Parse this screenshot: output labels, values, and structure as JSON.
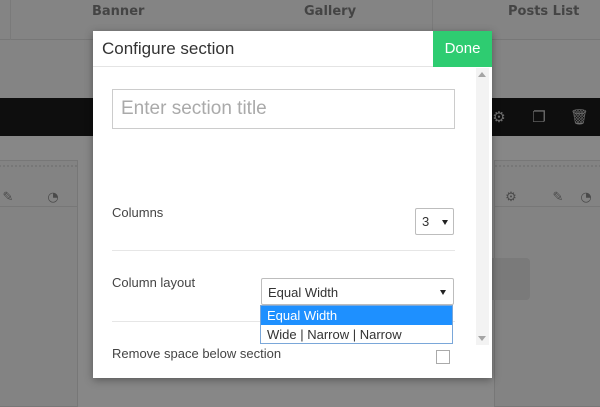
{
  "background": {
    "tabs": [
      "Banner",
      "Gallery",
      "Posts List"
    ]
  },
  "modal": {
    "title": "Configure section",
    "done_label": "Done",
    "section_title_placeholder": "Enter section title",
    "columns": {
      "label": "Columns",
      "value": "3"
    },
    "column_layout": {
      "label": "Column layout",
      "value": "Equal Width",
      "options": [
        "Equal Width",
        "Wide | Narrow | Narrow"
      ],
      "selected_index": 0
    },
    "remove_space": {
      "label": "Remove space below section",
      "checked": false
    }
  },
  "colors": {
    "done_button": "#2ecc71",
    "selected_option": "#1e90ff"
  }
}
